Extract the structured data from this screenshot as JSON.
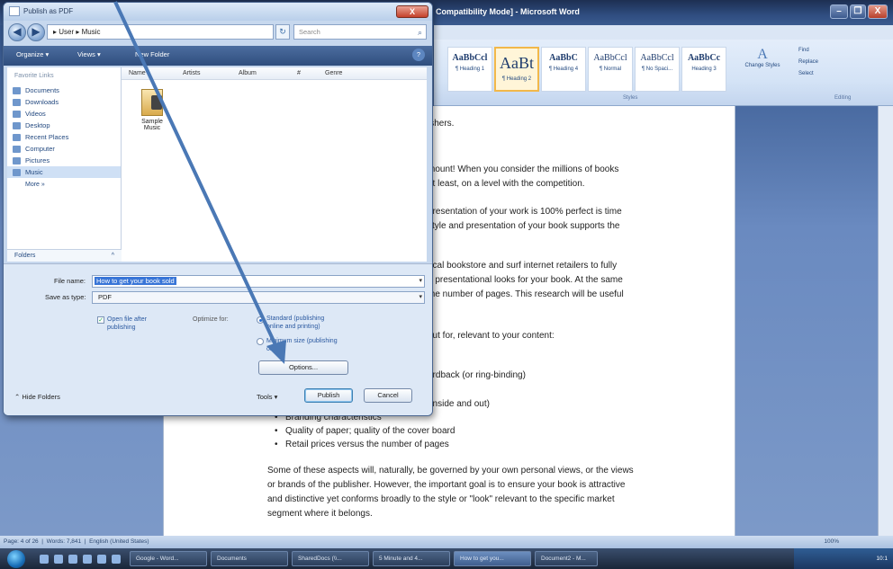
{
  "word": {
    "title": "Compatibility Mode] - Microsoft Word",
    "window_controls": [
      "–",
      "❐",
      "X"
    ],
    "styles": [
      {
        "sample": "AaBbCcl",
        "name": "¶ Heading 1",
        "selected": false,
        "big": false
      },
      {
        "sample": "AaBt",
        "name": "¶ Heading 2",
        "selected": true,
        "big": true
      },
      {
        "sample": "AaBbC",
        "name": "¶ Heading 4",
        "selected": false,
        "big": false
      },
      {
        "sample": "AaBbCcl",
        "name": "¶ Normal",
        "selected": false,
        "big": false
      },
      {
        "sample": "AaBbCcl",
        "name": "¶ No Spaci...",
        "selected": false,
        "big": false
      },
      {
        "sample": "AaBbCc",
        "name": "Heading 3",
        "selected": false,
        "big": false
      }
    ],
    "change_styles": {
      "glyph": "A",
      "label": "Change Styles"
    },
    "editing": {
      "find": "Find",
      "replace": "Replace",
      "select": "Select"
    },
    "group_labels": {
      "styles": "Styles",
      "editing": "Editing"
    },
    "document_lines": [
      "ishers.",
      "mount! When you consider the millions of books",
      "at least, on a level with the competition.",
      "presentation of your work is 100% perfect is time",
      "style and presentation of your book supports the",
      "ocal bookstore and surf internet retailers to fully",
      "d presentational looks for your book. At the same",
      "the number of pages. This research will be useful",
      "out for, relevant to your content:",
      "ardback (or ring-binding)",
      "(inside and out)"
    ],
    "bullets": [
      "Branding characteristics",
      "Quality of paper; quality of the cover board",
      "Retail prices versus the number of pages"
    ],
    "paragraph_last": [
      "Some of these aspects will, naturally, be governed by your own personal views, or the views",
      "or brands of the publisher. However, the important goal is to ensure your book is attractive",
      "and distinctive yet conforms broadly to the style or \"look\" relevant to the specific market",
      "segment where it belongs."
    ],
    "status": {
      "page": "Page: 4 of 26",
      "words": "Words: 7,841",
      "language": "English (United States)",
      "zoom": "100%"
    }
  },
  "taskbar": {
    "items": [
      "Google - Word...",
      "Documents",
      "SharedDocs (\\\\...",
      "5 Minute and 4...",
      "How to get you...",
      "Document2 - M..."
    ],
    "clock": "10:1"
  },
  "dialog": {
    "title": "Publish as PDF",
    "close": "X",
    "address": "▸ User ▸ Music",
    "search_placeholder": "Search",
    "toolbar": {
      "organize": "Organize ▾",
      "views": "Views ▾",
      "new_folder": "New Folder",
      "help": "?"
    },
    "nav_header": "Favorite Links",
    "nav_items": [
      "Documents",
      "Downloads",
      "Videos",
      "Desktop",
      "Recent Places",
      "Computer",
      "Pictures",
      "Music"
    ],
    "more": "More »",
    "folders": "Folders",
    "columns": [
      "Name",
      "Artists",
      "Album",
      "#",
      "Genre"
    ],
    "file": {
      "name": "Sample Music"
    },
    "file_name_label": "File name:",
    "file_name_value": "How to get your book sold",
    "save_type_label": "Save as type:",
    "save_type_value": "PDF",
    "open_after": "Open file after publishing",
    "optimize_label": "Optimize for:",
    "opt_standard": "Standard (publishing online and printing)",
    "opt_min": "Minimum size (publishing online)",
    "options_button": "Options...",
    "hide_folders": "Hide Folders",
    "tools": "Tools",
    "publish": "Publish",
    "cancel": "Cancel"
  }
}
